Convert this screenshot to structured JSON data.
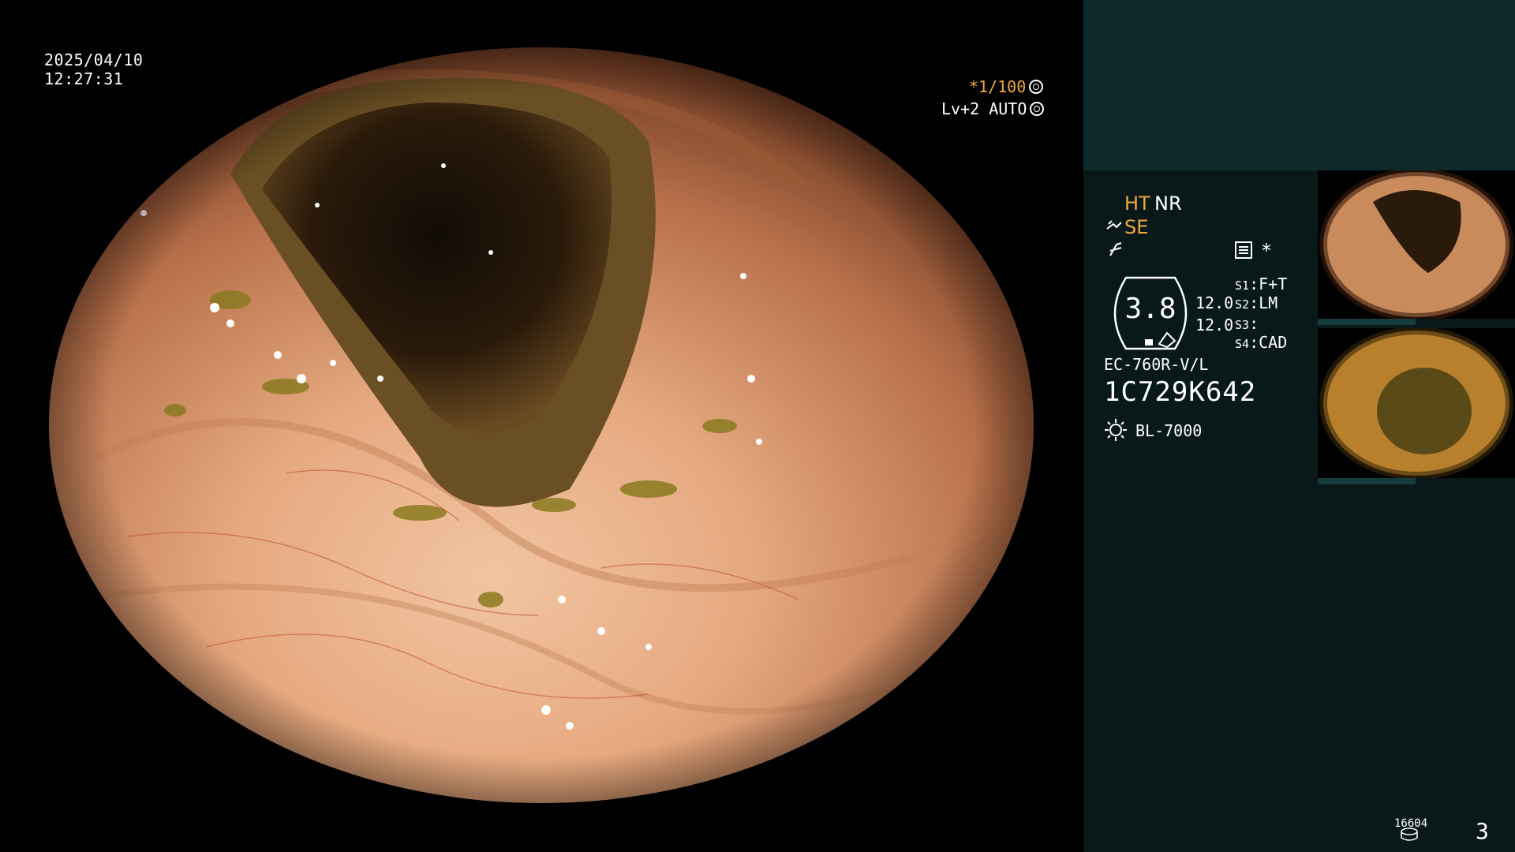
{
  "overlay": {
    "date": "2025/04/10",
    "time": "12:27:31",
    "shutter": "*1/100",
    "level": "Lv+2 AUTO"
  },
  "panel": {
    "ht": "HT",
    "nr": "NR",
    "se": "SE",
    "star": "*",
    "scope_value": "3.8",
    "value1": "12.0",
    "value2": "12.0",
    "switches": [
      {
        "key": "S1",
        "value": "F+T"
      },
      {
        "key": "S2",
        "value": "LM"
      },
      {
        "key": "S3",
        "value": ""
      },
      {
        "key": "S4",
        "value": "CAD"
      }
    ],
    "model": "EC-760R-V/L",
    "serial": "1C729K642",
    "light_source": "BL-7000",
    "count": "16604",
    "page": "3"
  },
  "colors": {
    "panel_bg": "#09191a",
    "panel_top": "#0e2a2b",
    "accent_orange": "#f2a93b"
  },
  "icons": [
    "wheel-icon",
    "aperture-icon",
    "se-tool-icon",
    "zap-icon",
    "menu-icon",
    "hex-gauge-icon",
    "sun-icon",
    "disk-icon"
  ]
}
